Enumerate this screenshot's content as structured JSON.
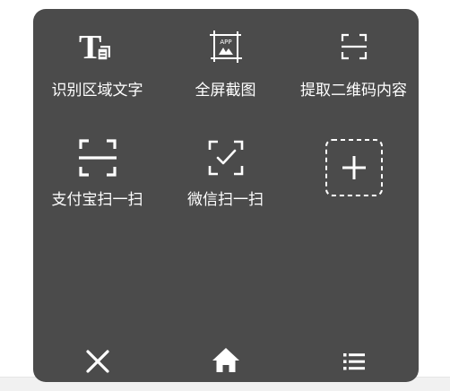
{
  "tools": [
    {
      "label": "识别区域文字",
      "icon": "text-recognition-icon"
    },
    {
      "label": "全屏截图",
      "icon": "fullscreen-screenshot-icon"
    },
    {
      "label": "提取二维码内容",
      "icon": "qr-extract-icon"
    },
    {
      "label": "支付宝扫一扫",
      "icon": "alipay-scan-icon"
    },
    {
      "label": "微信扫一扫",
      "icon": "wechat-scan-icon"
    },
    {
      "label": "",
      "icon": "add-icon"
    }
  ],
  "nav": {
    "close": "close-icon",
    "home": "home-icon",
    "menu": "menu-list-icon"
  },
  "colors": {
    "panel": "#4b4b4b",
    "foreground": "#ffffff"
  }
}
